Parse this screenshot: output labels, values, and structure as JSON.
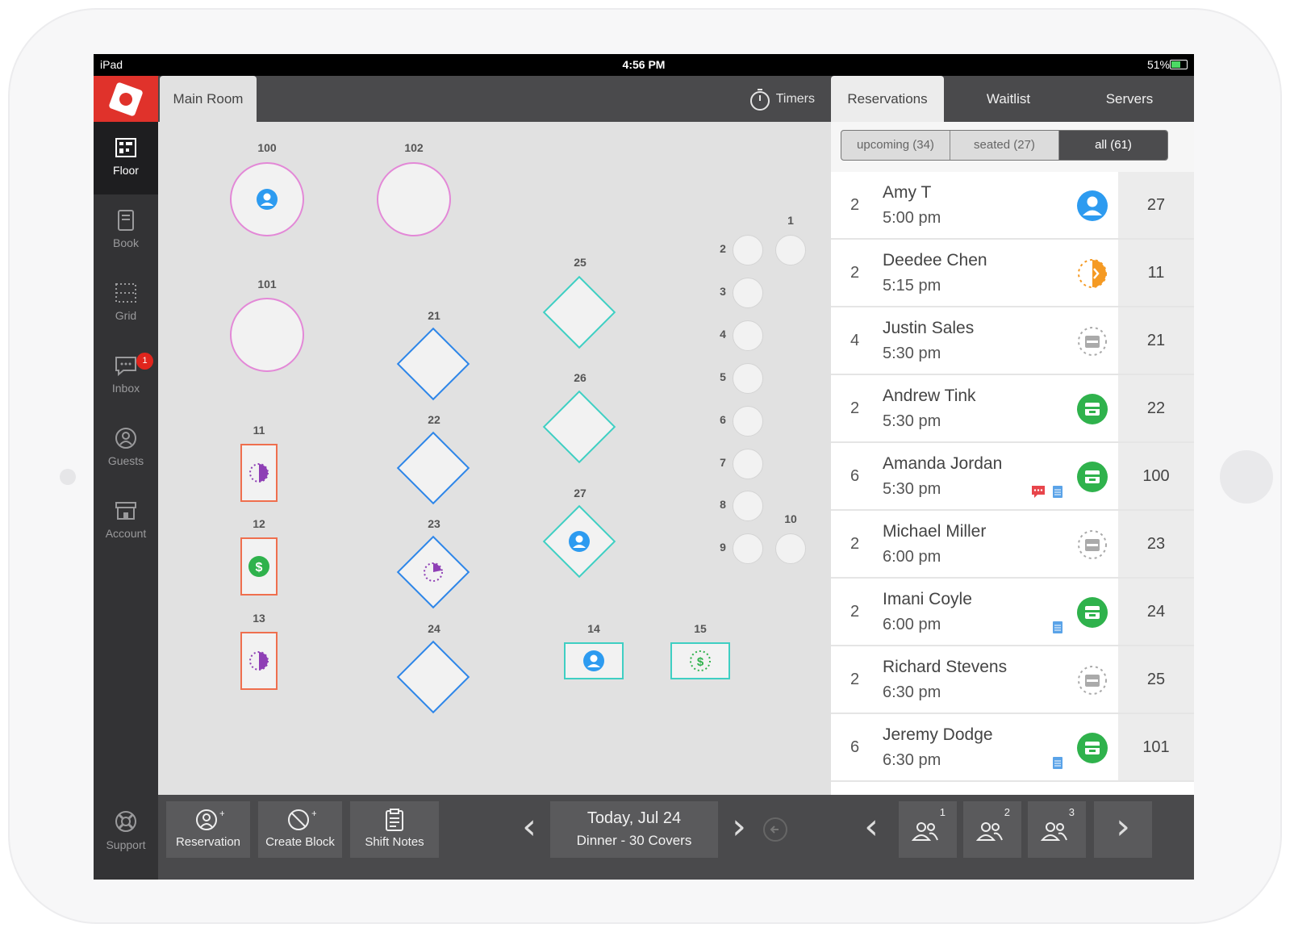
{
  "status_bar": {
    "carrier": "iPad",
    "time": "4:56 PM",
    "battery": "51%"
  },
  "sidebar": {
    "items": [
      {
        "label": "Floor",
        "icon": "floor-icon"
      },
      {
        "label": "Book",
        "icon": "book-icon"
      },
      {
        "label": "Grid",
        "icon": "grid-icon"
      },
      {
        "label": "Inbox",
        "icon": "inbox-icon",
        "badge": "1"
      },
      {
        "label": "Guests",
        "icon": "guests-icon"
      },
      {
        "label": "Account",
        "icon": "account-icon"
      }
    ],
    "support_label": "Support"
  },
  "topbar": {
    "room_tab": "Main Room",
    "timers_label": "Timers"
  },
  "floor": {
    "tables": [
      {
        "id": "100",
        "shape": "circle",
        "status": "person"
      },
      {
        "id": "102",
        "shape": "circle",
        "status": "empty"
      },
      {
        "id": "101",
        "shape": "circle",
        "status": "empty"
      },
      {
        "id": "21",
        "shape": "diamond",
        "status": "empty"
      },
      {
        "id": "22",
        "shape": "diamond",
        "status": "empty"
      },
      {
        "id": "23",
        "shape": "diamond",
        "status": "timer"
      },
      {
        "id": "24",
        "shape": "diamond",
        "status": "empty"
      },
      {
        "id": "25",
        "shape": "diamond",
        "status": "empty"
      },
      {
        "id": "26",
        "shape": "diamond",
        "status": "empty"
      },
      {
        "id": "27",
        "shape": "diamond",
        "status": "person"
      },
      {
        "id": "11",
        "shape": "rect",
        "status": "half"
      },
      {
        "id": "12",
        "shape": "rect",
        "status": "paid"
      },
      {
        "id": "13",
        "shape": "rect",
        "status": "half"
      },
      {
        "id": "14",
        "shape": "wide",
        "status": "person"
      },
      {
        "id": "15",
        "shape": "wide",
        "status": "dollar"
      },
      {
        "id": "1",
        "shape": "small"
      },
      {
        "id": "2",
        "shape": "small"
      },
      {
        "id": "3",
        "shape": "small"
      },
      {
        "id": "4",
        "shape": "small"
      },
      {
        "id": "5",
        "shape": "small"
      },
      {
        "id": "6",
        "shape": "small"
      },
      {
        "id": "7",
        "shape": "small"
      },
      {
        "id": "8",
        "shape": "small"
      },
      {
        "id": "9",
        "shape": "small"
      },
      {
        "id": "10",
        "shape": "small"
      }
    ]
  },
  "right_tabs": {
    "reservations": "Reservations",
    "waitlist": "Waitlist",
    "servers": "Servers"
  },
  "filters": {
    "upcoming": "upcoming (34)",
    "seated": "seated (27)",
    "all": "all (61)"
  },
  "reservations": [
    {
      "size": "2",
      "name": "Amy T",
      "time": "5:00 pm",
      "status": "person",
      "table": "27"
    },
    {
      "size": "2",
      "name": "Deedee Chen",
      "time": "5:15 pm",
      "status": "half-orange",
      "table": "11"
    },
    {
      "size": "4",
      "name": "Justin Sales",
      "time": "5:30 pm",
      "status": "calendar-grey",
      "table": "21"
    },
    {
      "size": "2",
      "name": "Andrew Tink",
      "time": "5:30 pm",
      "status": "calendar-green",
      "table": "22"
    },
    {
      "size": "6",
      "name": "Amanda Jordan",
      "time": "5:30 pm",
      "status": "calendar-green",
      "table": "100",
      "notes": [
        "chat-note-icon",
        "note-icon"
      ]
    },
    {
      "size": "2",
      "name": "Michael Miller",
      "time": "6:00 pm",
      "status": "calendar-grey",
      "table": "23"
    },
    {
      "size": "2",
      "name": "Imani Coyle",
      "time": "6:00 pm",
      "status": "calendar-green",
      "table": "24",
      "notes": [
        "note-icon"
      ]
    },
    {
      "size": "2",
      "name": "Richard Stevens",
      "time": "6:30 pm",
      "status": "calendar-grey",
      "table": "25"
    },
    {
      "size": "6",
      "name": "Jeremy Dodge",
      "time": "6:30 pm",
      "status": "calendar-green",
      "table": "101",
      "notes": [
        "note-icon"
      ]
    }
  ],
  "bottombar": {
    "reservation_label": "Reservation",
    "create_block_label": "Create Block",
    "shift_notes_label": "Shift Notes",
    "date_line1": "Today, Jul 24",
    "date_line2": "Dinner - 30 Covers",
    "party_buttons": [
      "1",
      "2",
      "3"
    ]
  },
  "colors": {
    "brand_red": "#e0322b",
    "reserved_pink": "#e388d7",
    "diamond_blue": "#2e86e8",
    "teal": "#3fcfc3",
    "rect_orange": "#ef6f4e",
    "status_blue": "#2d9bf0",
    "status_green": "#2fb24c",
    "status_orange": "#f59a23"
  }
}
